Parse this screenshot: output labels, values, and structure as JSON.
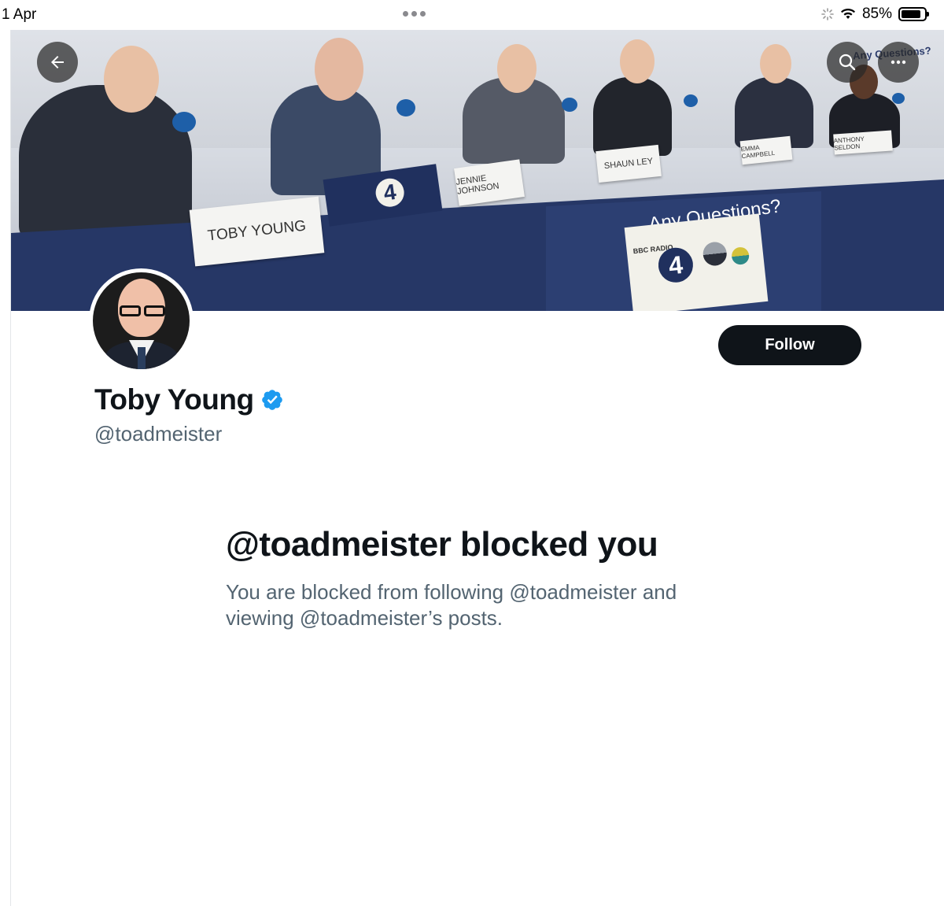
{
  "status_bar": {
    "date": "1 Apr",
    "battery_percent": "85%",
    "battery_level": 0.85
  },
  "header": {
    "back_icon": "arrow-left-icon",
    "search_icon": "search-icon",
    "more_icon": "more-horizontal-icon"
  },
  "banner": {
    "name_cards": [
      "TOBY YOUNG",
      "JENNIE JOHNSON",
      "SHAUN LEY",
      "EMMA CAMPBELL",
      "ANTHONY SELDON"
    ],
    "sign_title": "Any Questions?",
    "corner_sign": "Any Questions?",
    "radio_brand": "BBC RADIO",
    "radio_number": "4"
  },
  "profile": {
    "display_name": "Toby Young",
    "handle": "@toadmeister",
    "verified": true,
    "follow_label": "Follow"
  },
  "blocked": {
    "title": "@toadmeister blocked you",
    "line1": "You are blocked from following @toadmeister and",
    "line2": "viewing @toadmeister’s posts."
  },
  "colors": {
    "primary_text": "#0f1419",
    "secondary_text": "#536471",
    "verified_blue": "#1d9bf0",
    "follow_bg": "#0f1419"
  }
}
